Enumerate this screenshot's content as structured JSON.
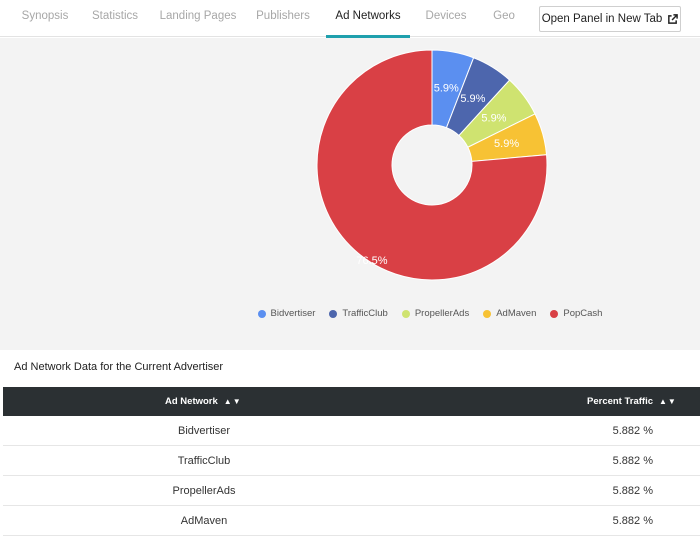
{
  "tabs": [
    {
      "label": "Synopsis",
      "active": false
    },
    {
      "label": "Statistics",
      "active": false
    },
    {
      "label": "Landing Pages",
      "active": false
    },
    {
      "label": "Publishers",
      "active": false
    },
    {
      "label": "Ad Networks",
      "active": true
    },
    {
      "label": "Devices",
      "active": false
    },
    {
      "label": "Geo",
      "active": false
    }
  ],
  "open_panel_label": "Open Panel in New Tab",
  "open_panel_icon": "external-link-icon",
  "chart_data": {
    "type": "pie",
    "donut": true,
    "title": "",
    "labels": [
      "Bidvertiser",
      "TrafficClub",
      "PropellerAds",
      "AdMaven",
      "PopCash"
    ],
    "values": [
      5.9,
      5.9,
      5.9,
      5.9,
      76.5
    ],
    "slice_labels": [
      "5.9%",
      "5.9%",
      "5.9%",
      "5.9%",
      "76.5%"
    ],
    "colors": [
      "#5b8ff0",
      "#4d66ad",
      "#cfe370",
      "#f7c234",
      "#d94045"
    ],
    "legend_position": "bottom"
  },
  "table": {
    "title": "Ad Network Data for the Current Advertiser",
    "headers": [
      "Ad Network",
      "Percent Traffic"
    ],
    "sort_icon": "▲▼",
    "rows": [
      [
        "Bidvertiser",
        "5.882 %"
      ],
      [
        "TrafficClub",
        "5.882 %"
      ],
      [
        "PropellerAds",
        "5.882 %"
      ],
      [
        "AdMaven",
        "5.882 %"
      ]
    ]
  }
}
